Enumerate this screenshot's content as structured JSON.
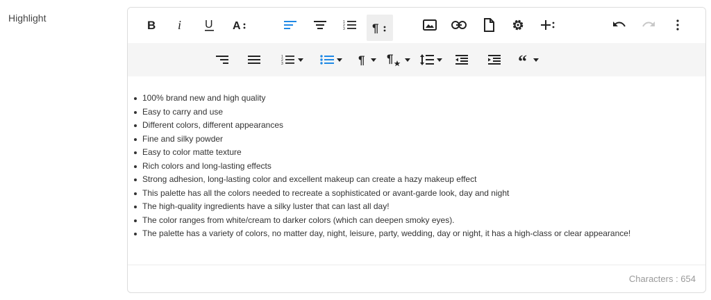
{
  "field": {
    "label": "Highlight"
  },
  "toolbar": {
    "row1": [
      {
        "icon": "bold-icon"
      },
      {
        "icon": "italic-icon"
      },
      {
        "icon": "underline-icon"
      },
      {
        "icon": "font-size-icon"
      },
      {
        "icon": "align-left-icon",
        "state": "active-blue"
      },
      {
        "icon": "align-center-icon"
      },
      {
        "icon": "ordered-list-icon"
      },
      {
        "icon": "paragraph-format-icon",
        "state": "pressed"
      },
      {
        "icon": "insert-image-icon"
      },
      {
        "icon": "insert-link-icon"
      },
      {
        "icon": "insert-file-icon"
      },
      {
        "icon": "settings-icon"
      },
      {
        "icon": "more-insert-icon"
      },
      {
        "icon": "undo-icon"
      },
      {
        "icon": "redo-icon",
        "state": "disabled"
      },
      {
        "icon": "more-vertical-icon"
      }
    ],
    "row2": [
      {
        "icon": "align-right-icon"
      },
      {
        "icon": "align-justify-icon"
      },
      {
        "icon": "ordered-list-dropdown-icon"
      },
      {
        "icon": "unordered-list-dropdown-icon",
        "state": "active-blue"
      },
      {
        "icon": "paragraph-style-icon"
      },
      {
        "icon": "paragraph-format-star-icon"
      },
      {
        "icon": "line-height-icon"
      },
      {
        "icon": "outdent-icon"
      },
      {
        "icon": "indent-icon"
      },
      {
        "icon": "quote-icon"
      }
    ]
  },
  "colors": {
    "accent": "#1e88e5",
    "border": "#dcdcdc",
    "toolbar_bg": "#f5f5f5",
    "pressed_bg": "#eeeeee"
  },
  "content": {
    "items": [
      "100% brand new and high quality",
      "Easy to carry and use",
      "Different colors, different appearances",
      "Fine and silky powder",
      "Easy to color matte texture",
      "Rich colors and long-lasting effects",
      "Strong adhesion, long-lasting color and excellent makeup can create a hazy makeup effect",
      "This palette has all the colors needed to recreate a sophisticated or avant-garde look, day and night",
      "The high-quality ingredients have a silky luster that can last all day!",
      "The color ranges from white/cream to darker colors (which can deepen smoky eyes).",
      "The palette has a variety of colors, no matter day, night, leisure, party, wedding, day or night, it has a high-class or clear appearance!"
    ]
  },
  "footer": {
    "char_count_label": "Characters : 654"
  }
}
